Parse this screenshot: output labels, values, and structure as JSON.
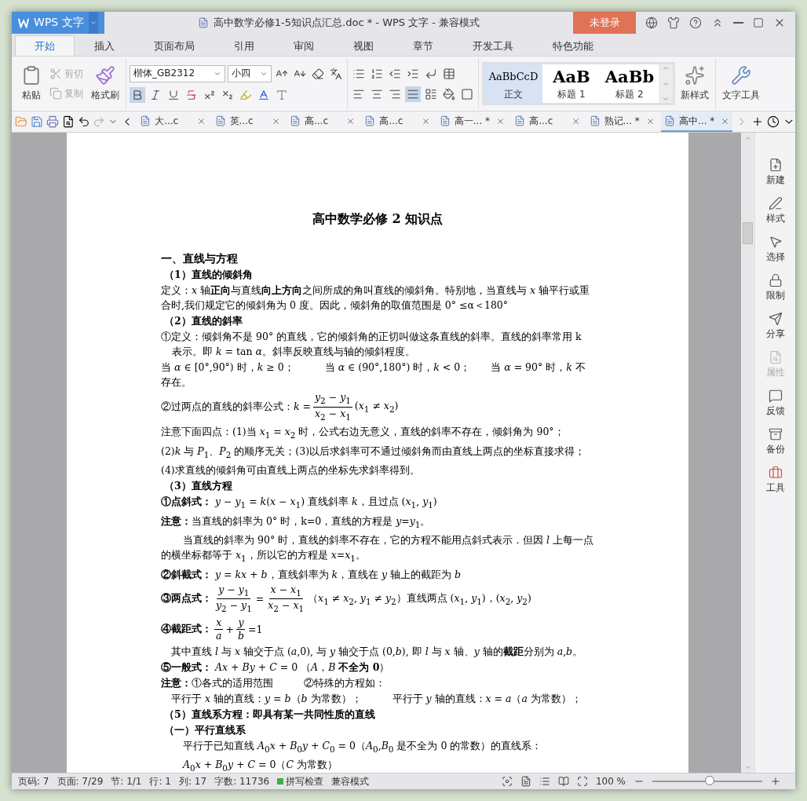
{
  "window": {
    "app_menu": "WPS 文字",
    "title": "高中数学必修1-5知识点汇总.doc * - WPS 文字 - 兼容模式",
    "login": "未登录"
  },
  "menu_tabs": [
    {
      "label": "开始",
      "selected": true
    },
    {
      "label": "插入",
      "selected": false
    },
    {
      "label": "页面布局",
      "selected": false
    },
    {
      "label": "引用",
      "selected": false
    },
    {
      "label": "审阅",
      "selected": false
    },
    {
      "label": "视图",
      "selected": false
    },
    {
      "label": "章节",
      "selected": false
    },
    {
      "label": "开发工具",
      "selected": false
    },
    {
      "label": "特色功能",
      "selected": false
    }
  ],
  "ribbon": {
    "paste": "粘贴",
    "cut": {
      "label": "剪切",
      "disabled": true
    },
    "copy": {
      "label": "复制",
      "disabled": true
    },
    "format_painter": "格式刷",
    "font": "楷体_GB2312",
    "size": "小四",
    "bold_on": true,
    "justify_on": true,
    "styles": [
      {
        "preview": "AaBbCcD",
        "label": "正文",
        "selected": true
      },
      {
        "preview": "AaB",
        "label": "标题 1",
        "selected": false
      },
      {
        "preview": "AaBb",
        "label": "标题 2",
        "selected": false
      }
    ],
    "new_style": "新样式",
    "text_tools": "文字工具"
  },
  "doc_tabs": [
    {
      "label": "大...c",
      "selected": false
    },
    {
      "label": "英...c",
      "selected": false
    },
    {
      "label": "高...c",
      "selected": false
    },
    {
      "label": "高...c",
      "selected": false
    },
    {
      "label": "高一... *",
      "selected": false
    },
    {
      "label": "高...c",
      "selected": false
    },
    {
      "label": "熟记... *",
      "selected": false
    },
    {
      "label": "高中... *",
      "selected": true
    }
  ],
  "document": {
    "title": "高中数学必修 2 知识点",
    "lines": [
      {
        "kind": "heading",
        "text": "一、直线与方程"
      },
      {
        "kind": "subheading",
        "text": "（1）直线的倾斜角"
      },
      {
        "kind": "para",
        "text": "定义：*x* 轴**正向**与直线**向上方向**之间所成的角叫直线的倾斜角。特别地，当直线与 *x* 轴平行或重合时,我们规定它的倾斜角为 0 度。因此，倾斜角的取值范围是 0° ≤α＜180°"
      },
      {
        "kind": "subheading",
        "text": "（2）直线的斜率"
      },
      {
        "kind": "hang",
        "text": "①定义：倾斜角不是 90° 的直线，它的倾斜角的正切叫做这条直线的斜率。直线的斜率常用 k 表示。即 *k* = tan *α*。斜率反映直线与轴的倾斜程度。"
      },
      {
        "kind": "para",
        "text": "当 *α* ∈ [0°,90°) 时，*k* ≥ 0；　　　当 *α* ∈ (90°,180°) 时，*k* < 0；　　当 *α* = 90° 时，*k* 不存在。"
      },
      {
        "kind": "para",
        "parts": [
          {
            "kind": "text",
            "text": "②过两点的直线的斜率公式：*k* ="
          },
          {
            "kind": "frac",
            "num": "*y*$_{2}$ − *y*$_{1}$",
            "den": "*x*$_{2}$ − *x*$_{1}$"
          },
          {
            "kind": "text",
            "text": "(*x*$_{1}$ ≠ *x*$_{2}$)"
          }
        ]
      },
      {
        "kind": "para",
        "text": "注意下面四点：(1)当 *x*$_{1}$ = *x*$_{2}$ 时，公式右边无意义，直线的斜率不存在，倾斜角为 90°；"
      },
      {
        "kind": "para",
        "text": "(2)*k* 与 *P*$_{1}$、*P*$_{2}$ 的顺序无关；(3)以后求斜率可不通过倾斜角而由直线上两点的坐标直接求得；"
      },
      {
        "kind": "para",
        "text": "(4)求直线的倾斜角可由直线上两点的坐标先求斜率得到。"
      },
      {
        "kind": "subheading",
        "text": "（3）直线方程"
      },
      {
        "kind": "para",
        "text": "**①点斜式：** *y* − *y*$_{1}$ = *k*(*x* − *x*$_{1}$) 直线斜率 *k*，且过点 (*x*$_{1}$, *y*$_{1}$)"
      },
      {
        "kind": "para",
        "text": "**注意：**当直线的斜率为 0° 时，k=0，直线的方程是 *y*=*y*$_{1}$。"
      },
      {
        "kind": "indent",
        "text": "当直线的斜率为 90° 时，直线的斜率不存在，它的方程不能用点斜式表示．但因 *l* 上每一点的横坐标都等于 *x*$_{1}$，所以它的方程是 *x*=*x*$_{1}$。"
      },
      {
        "kind": "para",
        "text": "**②斜截式：** *y* = *kx* + *b*，直线斜率为 *k*，直线在 *y* 轴上的截距为 *b*"
      },
      {
        "kind": "para",
        "parts": [
          {
            "kind": "text",
            "text": "**③两点式：**"
          },
          {
            "kind": "frac",
            "num": "*y* − *y*$_{1}$",
            "den": "*y*$_{2}$ − *y*$_{1}$"
          },
          {
            "kind": "text",
            "text": "="
          },
          {
            "kind": "frac",
            "num": "*x* − *x*$_{1}$",
            "den": "*x*$_{2}$ − *x*$_{1}$"
          },
          {
            "kind": "text",
            "text": "（*x*$_{1}$ ≠ *x*$_{2}$, *y*$_{1}$ ≠ *y*$_{2}$）直线两点 (*x*$_{1}$, *y*$_{1}$)，(*x*$_{2}$, *y*$_{2}$)"
          }
        ]
      },
      {
        "kind": "para",
        "parts": [
          {
            "kind": "text",
            "text": "**④截距式：**"
          },
          {
            "kind": "frac",
            "num": "*x*",
            "den": "*a*"
          },
          {
            "kind": "text",
            "text": "+"
          },
          {
            "kind": "frac",
            "num": "*y*",
            "den": "*b*"
          },
          {
            "kind": "text",
            "text": "=1"
          }
        ]
      },
      {
        "kind": "para",
        "text": "　其中直线 *l* 与 *x* 轴交于点 (*a*,0), 与 *y* 轴交于点 (0,*b*), 即 *l* 与 *x* 轴、*y* 轴的**截距**分别为 *a*,*b*。"
      },
      {
        "kind": "para",
        "text": "**⑤一般式：** *Ax* + *By* + *C* = 0 （*A*，*B* **不全为 0**）"
      },
      {
        "kind": "para",
        "text": "**注意：**①各式的适用范围　　　②特殊的方程如："
      },
      {
        "kind": "para",
        "text": "　平行于 *x* 轴的直线：*y* = *b*（*b* 为常数）；　　　平行于 *y* 轴的直线：*x* = *a*（*a* 为常数）；"
      },
      {
        "kind": "subheading",
        "text": "（5）直线系方程：即具有某一共同性质的直线"
      },
      {
        "kind": "subheading",
        "text": "（一）平行直线系"
      },
      {
        "kind": "indent",
        "text": "平行于已知直线 *A*$_{0}$*x* + *B*$_{0}$*y* + *C*$_{0}$ = 0（*A*$_{0}$,*B*$_{0}$ 是不全为 0 的常数）的直线系："
      },
      {
        "kind": "indent",
        "text": "*A*$_{0}$*x* + *B*$_{0}$*y* + *C* = 0（*C* 为常数）"
      }
    ]
  },
  "side_panel": [
    {
      "label": "新建",
      "disabled": false
    },
    {
      "label": "样式",
      "disabled": false
    },
    {
      "label": "选择",
      "disabled": false
    },
    {
      "label": "限制",
      "disabled": false
    },
    {
      "label": "分享",
      "disabled": false
    },
    {
      "label": "属性",
      "disabled": true
    },
    {
      "label": "反馈",
      "disabled": false
    },
    {
      "label": "备份",
      "disabled": false
    },
    {
      "label": "工具",
      "disabled": false
    }
  ],
  "status_bar": {
    "items": [
      "页码: 7",
      "页面: 7/29",
      "节: 1/1",
      "行: 1",
      "列: 17",
      "字数: 11736"
    ],
    "spell_check": {
      "label": "拼写检查",
      "on": true
    },
    "mode": "兼容模式",
    "zoom": {
      "label": "100 %",
      "level": 0.53
    }
  }
}
